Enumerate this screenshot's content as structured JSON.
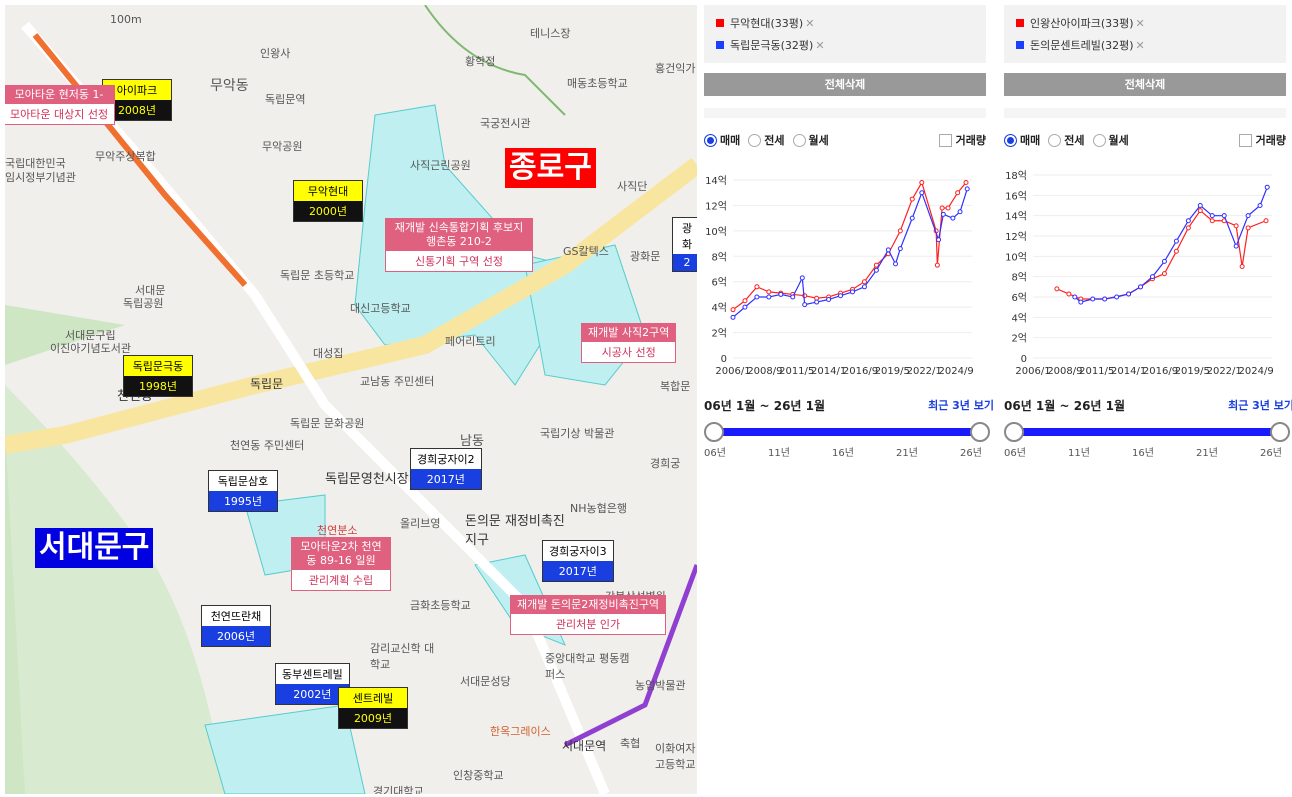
{
  "map": {
    "districts": [
      "종로구",
      "서대문구"
    ],
    "labels": [
      "100m",
      "인왕사",
      "무악동",
      "독립문역",
      "무악공원",
      "무악주상복합",
      "국립대한민국",
      "임시정부기념관",
      "서대문",
      "독립공원",
      "서대문구립",
      "이진아기념도서관",
      "대성집",
      "독립문",
      "천연동",
      "천연동 주민센터",
      "독립문 문화공원",
      "교남동 주민센터",
      "대신고등학교",
      "독립문 초등학교",
      "사직근린공원",
      "황학정",
      "국궁전시관",
      "테니스장",
      "매동초등학교",
      "홍건익가",
      "사직단",
      "GS칼텍스",
      "광화문",
      "페어리트리",
      "국립기상 박물관",
      "경희궁",
      "NH농협은행",
      "복합문",
      "독립문영천시장",
      "돈의문 재정비촉진지구",
      "올리브영",
      "천연분소",
      "금화초등학교",
      "감리교신학 대학교",
      "중앙대학교 평동캠퍼스",
      "서대문성당",
      "한옥그레이스",
      "서대문역",
      "농업박물관",
      "이화여자 고등학교",
      "인창중학교",
      "경기대학교",
      "축협",
      "강북삼성병원",
      "남동"
    ],
    "apartments": [
      {
        "name": "아이파크",
        "year": "2008년"
      },
      {
        "name": "무악현대",
        "year": "2000년"
      },
      {
        "name": "독립문극동",
        "year": "1998년"
      },
      {
        "name": "독립문삼호",
        "year": "1995년"
      },
      {
        "name": "경희궁자이2",
        "year": "2017년"
      },
      {
        "name": "경희궁자이3",
        "year": "2017년"
      },
      {
        "name": "천연뜨란채",
        "year": "2006년"
      },
      {
        "name": "동부센트레빌",
        "year": "2002년"
      },
      {
        "name": "센트레빌",
        "year": "2009년"
      },
      {
        "name": "광화",
        "year": "2"
      }
    ],
    "zones": [
      {
        "title": "모아타운 현저동 1-",
        "sub": "모아타운 대상지 선정"
      },
      {
        "title": "재개발 신속통합기획 후보지 행촌동 210-2",
        "sub": "신통기획 구역 선정"
      },
      {
        "title": "재개발 사직2구역",
        "sub": "시공사 선정"
      },
      {
        "title": "모아타운2차 천연동 89-16 일원",
        "sub": "관리계획 수립"
      },
      {
        "title": "재개발 돈의문2재정비촉진구역",
        "sub": "관리처분 인가"
      }
    ]
  },
  "panels": [
    {
      "items": [
        {
          "name": "무악현대(33평)",
          "color": "#ff0000"
        },
        {
          "name": "독립문극동(32평)",
          "color": "#1a3fff"
        }
      ],
      "delete_all": "전체삭제",
      "radios": [
        "매매",
        "전세",
        "월세"
      ],
      "selected": "매매",
      "volume": "거래량",
      "range_text": "06년 1월 ~ 26년 1월",
      "recent": "최근 3년 보기",
      "range_ticks": [
        "06년",
        "11년",
        "16년",
        "21년",
        "26년"
      ]
    },
    {
      "items": [
        {
          "name": "인왕산아이파크(33평)",
          "color": "#ff0000"
        },
        {
          "name": "돈의문센트레빌(32평)",
          "color": "#1a3fff"
        }
      ],
      "delete_all": "전체삭제",
      "radios": [
        "매매",
        "전세",
        "월세"
      ],
      "selected": "매매",
      "volume": "거래량",
      "range_text": "06년 1월 ~ 26년 1월",
      "recent": "최근 3년 보기",
      "range_ticks": [
        "06년",
        "11년",
        "16년",
        "21년",
        "26년"
      ]
    }
  ],
  "chart_data": [
    {
      "type": "line",
      "ylim": [
        0,
        14
      ],
      "yticks": [
        "0",
        "2억",
        "4억",
        "6억",
        "8억",
        "10억",
        "12억",
        "14억"
      ],
      "xlim": [
        2006,
        2026
      ],
      "xticks": [
        "2006/1",
        "2008/9",
        "2011/5",
        "2014/1",
        "2016/9",
        "2019/5",
        "2022/1",
        "2024/9"
      ],
      "series": [
        {
          "name": "무악현대(33평)",
          "color": "#ff2020",
          "x": [
            2006,
            2007,
            2008,
            2009,
            2010,
            2011,
            2012,
            2013,
            2014,
            2015,
            2016,
            2017,
            2018,
            2019,
            2020,
            2021,
            2021.8,
            2023,
            2023.1,
            2023.5,
            2024,
            2024.8,
            2025.5
          ],
          "y": [
            3.8,
            4.5,
            5.6,
            5.2,
            5.1,
            5.0,
            4.9,
            4.7,
            4.8,
            5.1,
            5.4,
            6.0,
            7.3,
            8.2,
            10.0,
            12.5,
            13.8,
            10.0,
            7.3,
            11.8,
            11.8,
            13.0,
            13.8
          ]
        },
        {
          "name": "독립문극동(32평)",
          "color": "#3030ff",
          "x": [
            2006,
            2007,
            2008,
            2009,
            2010,
            2011,
            2011.8,
            2012,
            2013,
            2014,
            2015,
            2016,
            2017,
            2018,
            2019,
            2019.6,
            2020,
            2021,
            2021.8,
            2023.2,
            2023.6,
            2024.4,
            2025,
            2025.6
          ],
          "y": [
            3.2,
            4.0,
            4.8,
            4.8,
            5.0,
            4.8,
            6.3,
            4.2,
            4.4,
            4.6,
            4.9,
            5.2,
            5.6,
            6.9,
            8.5,
            7.4,
            8.6,
            11.0,
            13.0,
            9.3,
            11.3,
            11.0,
            11.5,
            13.3
          ]
        }
      ]
    },
    {
      "type": "line",
      "ylim": [
        0,
        18
      ],
      "yticks": [
        "0",
        "2억",
        "4억",
        "6억",
        "8억",
        "10억",
        "12억",
        "14억",
        "16억",
        "18억"
      ],
      "xlim": [
        2006,
        2026
      ],
      "xticks": [
        "2006/1",
        "2008/9",
        "2011/5",
        "2014/1",
        "2016/9",
        "2019/5",
        "2022/1",
        "2024/9"
      ],
      "series": [
        {
          "name": "인왕산아이파크(33평)",
          "color": "#ff2020",
          "x": [
            2008,
            2009,
            2010,
            2012,
            2014,
            2015,
            2016,
            2017,
            2018,
            2019,
            2020,
            2021,
            2022,
            2023,
            2023.5,
            2024,
            2025.5
          ],
          "y": [
            6.8,
            6.3,
            5.8,
            5.8,
            6.3,
            7.0,
            7.8,
            8.3,
            10.5,
            12.8,
            14.5,
            13.5,
            13.5,
            13.0,
            9.0,
            12.8,
            13.5
          ]
        },
        {
          "name": "돈의문센트레빌(32평)",
          "color": "#3030ff",
          "x": [
            2009.5,
            2010,
            2011,
            2012,
            2013,
            2014,
            2015,
            2016,
            2017,
            2018,
            2019,
            2020,
            2021,
            2022,
            2023,
            2024,
            2025,
            2025.6
          ],
          "y": [
            6.0,
            5.5,
            5.8,
            5.8,
            6.0,
            6.3,
            7.0,
            8.0,
            9.5,
            11.5,
            13.5,
            15.0,
            14.0,
            14.0,
            11.0,
            14.0,
            15.0,
            16.8
          ]
        }
      ]
    }
  ]
}
